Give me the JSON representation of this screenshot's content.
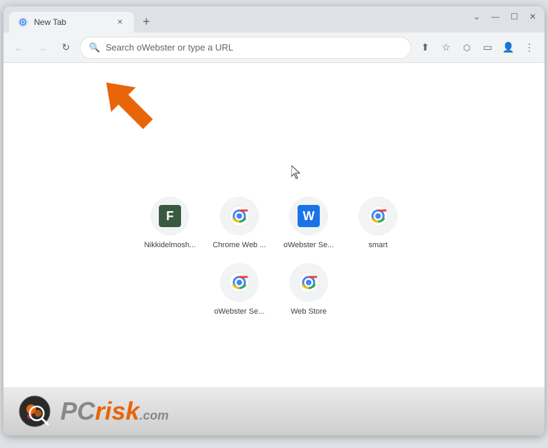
{
  "window": {
    "title": "New Tab",
    "controls": {
      "minimize": "—",
      "maximize": "☐",
      "close": "✕"
    }
  },
  "tabs": [
    {
      "label": "New Tab",
      "active": true
    }
  ],
  "new_tab_button": "+",
  "nav": {
    "back_label": "←",
    "forward_label": "→",
    "reload_label": "↺",
    "address_placeholder": "Search oWebster or type a URL",
    "actions": {
      "share": "⬆",
      "bookmark": "☆",
      "extensions": "🧩",
      "cast": "▭",
      "profile": "👤",
      "menu": "⋮"
    }
  },
  "shortcuts": {
    "row1": [
      {
        "id": "nikkidelmosh",
        "label": "Nikkidelmosh...",
        "type": "letter",
        "letter": "F",
        "bg": "#3a5a40"
      },
      {
        "id": "chrome-web-1",
        "label": "Chrome Web ...",
        "type": "chrome"
      },
      {
        "id": "owebster-se-1",
        "label": "oWebster Se...",
        "type": "w",
        "letter": "W",
        "bg": "#1a73e8"
      },
      {
        "id": "smart",
        "label": "smart",
        "type": "chrome"
      }
    ],
    "row2": [
      {
        "id": "owebster-se-2",
        "label": "oWebster Se...",
        "type": "chrome"
      },
      {
        "id": "web-store",
        "label": "Web Store",
        "type": "chrome"
      }
    ]
  },
  "pcrisk": {
    "pc": "PC",
    "risk": "risk",
    "dot": ".",
    "com": "com"
  }
}
